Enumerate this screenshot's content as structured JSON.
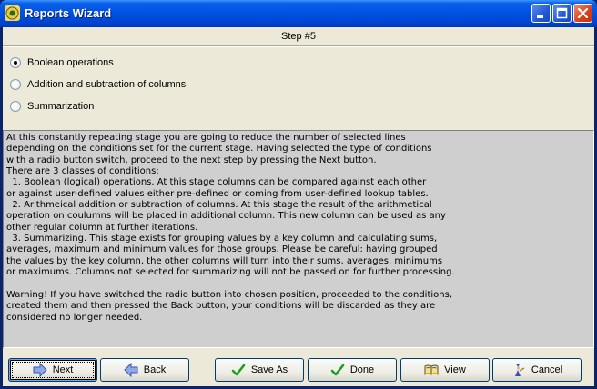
{
  "window": {
    "title": "Reports Wizard",
    "title_icon": "wizard-icon",
    "controls": [
      "minimize-icon",
      "maximize-icon",
      "close-icon"
    ]
  },
  "step": {
    "label": "Step #5"
  },
  "options": [
    {
      "label": "Boolean operations",
      "checked": true
    },
    {
      "label": "Addition and subtraction of columns",
      "checked": false
    },
    {
      "label": "Summarization",
      "checked": false
    }
  ],
  "description": "At this constantly repeating stage you are going to reduce the number of selected lines\ndepending on the conditions set for the current stage. Having selected the type of conditions\nwith a radio button switch, proceed to the next step by pressing the Next button.\nThere are 3 classes of conditions:\n  1. Boolean (logical) operations. At this stage columns can be compared against each other\nor against user-defined values either pre-defined or coming from user-defined lookup tables.\n  2. Arithmeical addition or subtraction of columns. At this stage the result of the arithmetical\noperation on coulumns will be placed in additional column. This new column can be used as any\nother regular column at further iterations.\n  3. Summarizing. This stage exists for grouping values by a key column and calculating sums,\naverages, maximum and minimum values for those groups. Please be careful: having grouped\nthe values by the key column, the other columns will turn into their sums, averages, minimums\nor maximums. Columns not selected for summarizing will not be passed on for further processing.\n\nWarning! If you have switched the radio button into chosen position, proceeded to the conditions,\ncreated them and then pressed the Back button, your conditions will be discarded as they are\nconsidered no longer needed.",
  "buttons": {
    "next": {
      "label": "Next",
      "icon": "arrow-right-icon"
    },
    "back": {
      "label": "Back",
      "icon": "arrow-left-icon"
    },
    "save_as": {
      "label": "Save As",
      "icon": "checkmark-icon"
    },
    "done": {
      "label": "Done",
      "icon": "checkmark-icon"
    },
    "view": {
      "label": "View",
      "icon": "book-icon"
    },
    "cancel": {
      "label": "Cancel",
      "icon": "wizard-figure-icon"
    }
  },
  "colors": {
    "titlebar": "#0055E5",
    "dialog_bg": "#ECE9D8",
    "text_panel_bg": "#CFCFCF",
    "button_border": "#003C74"
  }
}
